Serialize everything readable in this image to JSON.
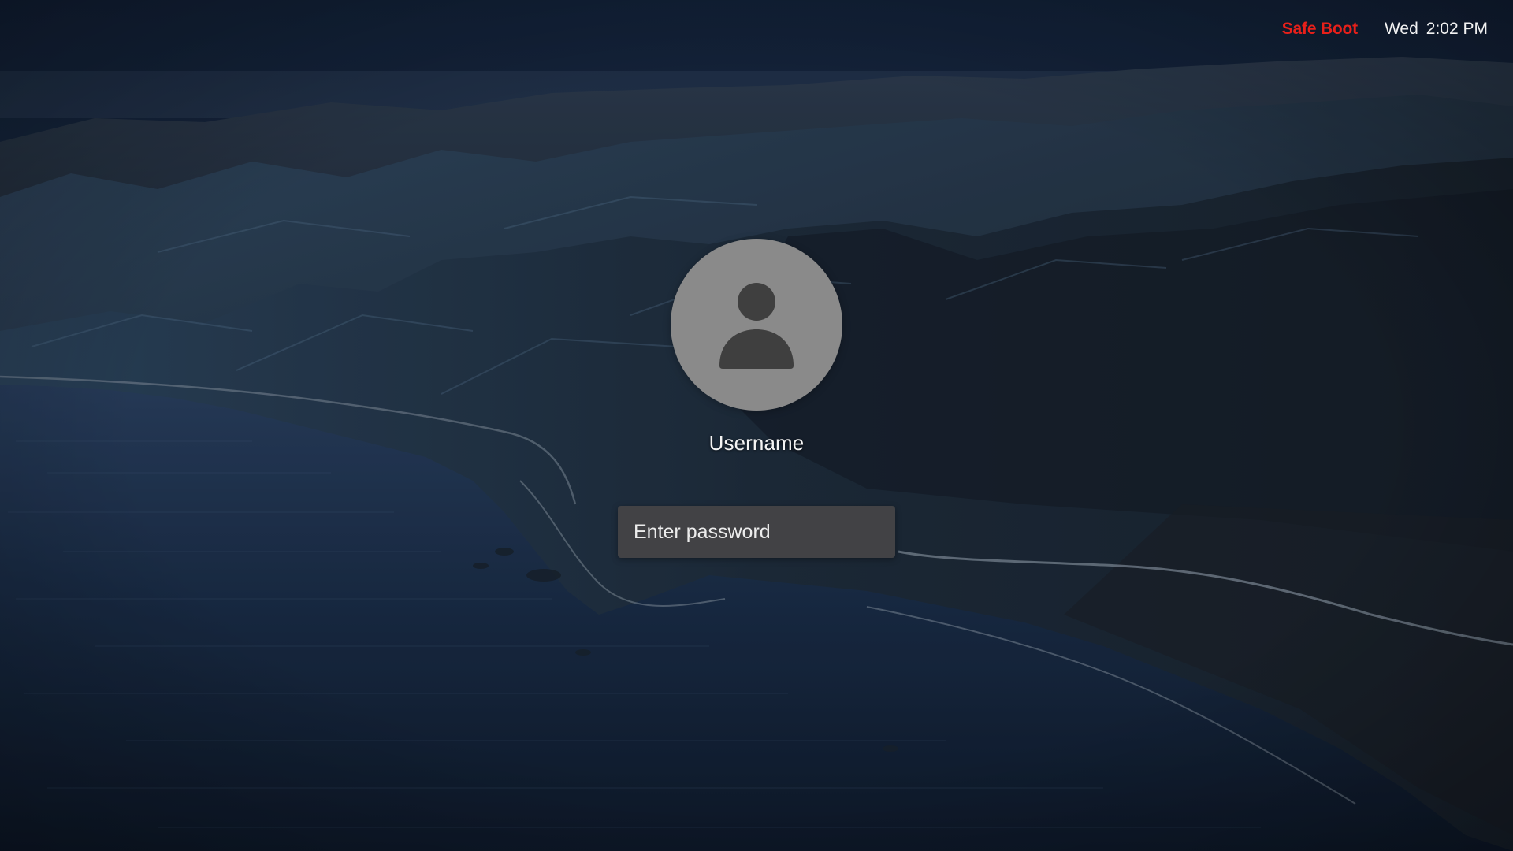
{
  "menubar": {
    "mode_label": "Safe Boot",
    "day": "Wed",
    "time": "2:02 PM"
  },
  "login": {
    "avatar_icon": "person-icon",
    "username": "Username",
    "password_placeholder": "Enter password",
    "password_value": ""
  },
  "colors": {
    "safe_boot": "#e8201a",
    "avatar_bg": "#8a8a8a",
    "avatar_glyph": "#3f3f3f",
    "field_bg": "#444446"
  }
}
